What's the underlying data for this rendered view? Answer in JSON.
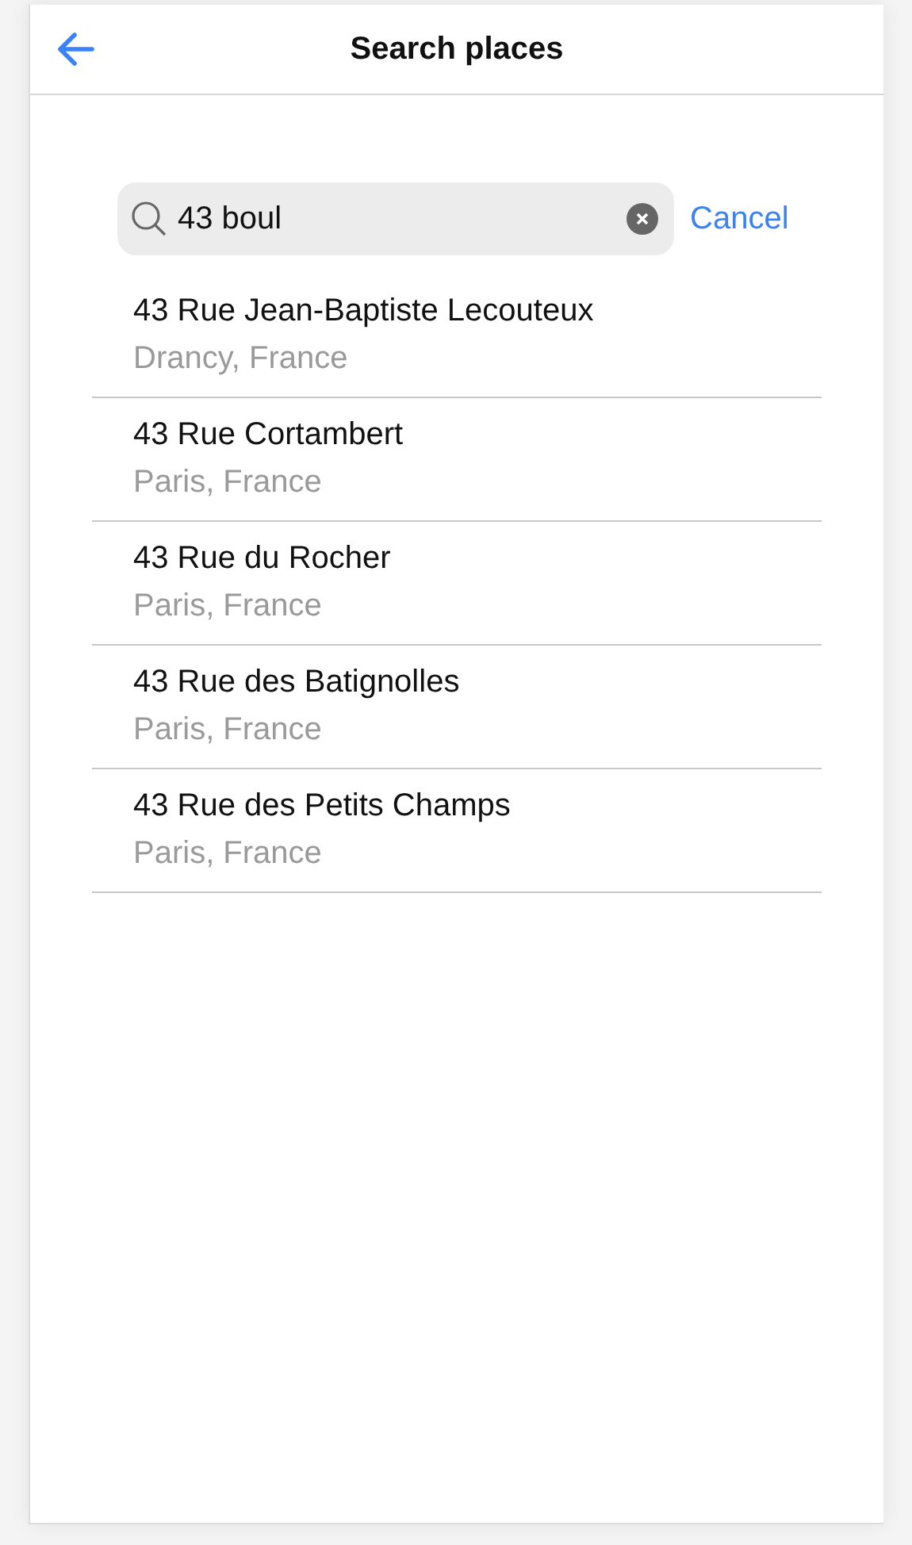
{
  "header": {
    "title": "Search places"
  },
  "search": {
    "value": "43 boul"
  },
  "cancel": "Cancel",
  "results": [
    {
      "title": "43 Rue Jean-Baptiste Lecouteux",
      "subtitle": "Drancy, France"
    },
    {
      "title": "43 Rue Cortambert",
      "subtitle": "Paris, France"
    },
    {
      "title": "43 Rue du Rocher",
      "subtitle": "Paris, France"
    },
    {
      "title": "43 Rue des Batignolles",
      "subtitle": "Paris, France"
    },
    {
      "title": "43 Rue des Petits Champs",
      "subtitle": "Paris, France"
    }
  ]
}
